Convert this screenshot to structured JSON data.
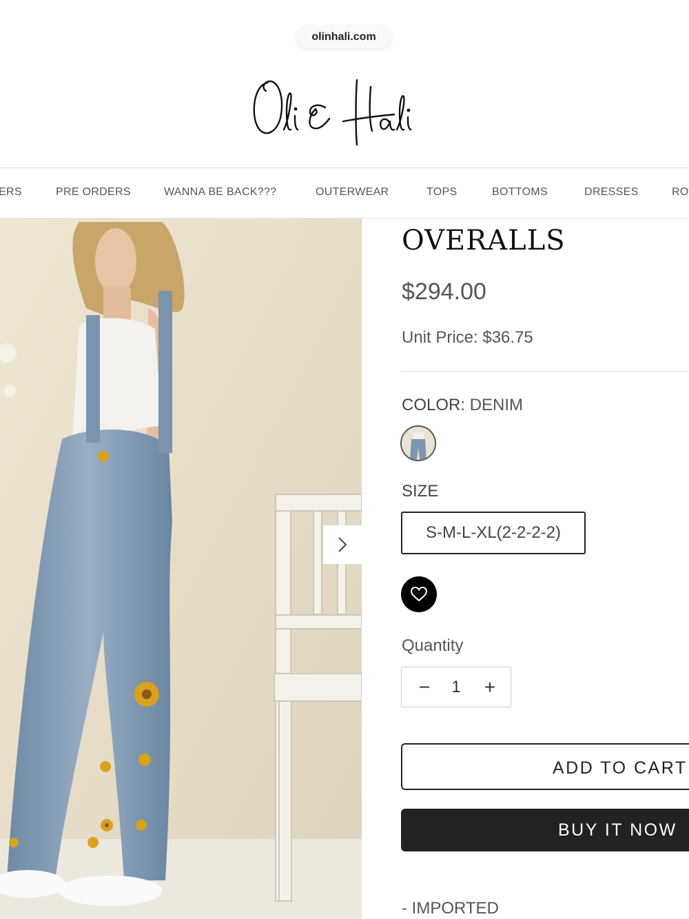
{
  "browser": {
    "url": "olinhali.com"
  },
  "brand": {
    "logo_text": "Oli & Hali"
  },
  "nav": {
    "items": [
      {
        "label": "ERS"
      },
      {
        "label": "PRE ORDERS"
      },
      {
        "label": "WANNA BE BACK???"
      },
      {
        "label": "OUTERWEAR"
      },
      {
        "label": "TOPS"
      },
      {
        "label": "BOTTOMS"
      },
      {
        "label": "DRESSES"
      },
      {
        "label": "RO"
      }
    ]
  },
  "gallery": {
    "next_icon": "chevron-right-icon"
  },
  "product": {
    "title": "OVERALLS",
    "price": "$294.00",
    "unit_price": "Unit Price: $36.75",
    "color_key": "COLOR:",
    "color_value": "DENIM",
    "size_label": "SIZE",
    "size_option": "S-M-L-XL(2-2-2-2)",
    "wishlist_icon": "heart-icon",
    "quantity_label": "Quantity",
    "quantity_minus": "−",
    "quantity_value": "1",
    "quantity_plus": "+",
    "add_to_cart": "ADD TO CART",
    "buy_now": "BUY IT NOW",
    "description_line": "- IMPORTED"
  },
  "colors": {
    "accent": "#222222",
    "text_muted": "#555555",
    "divider": "#dcdcdc"
  }
}
